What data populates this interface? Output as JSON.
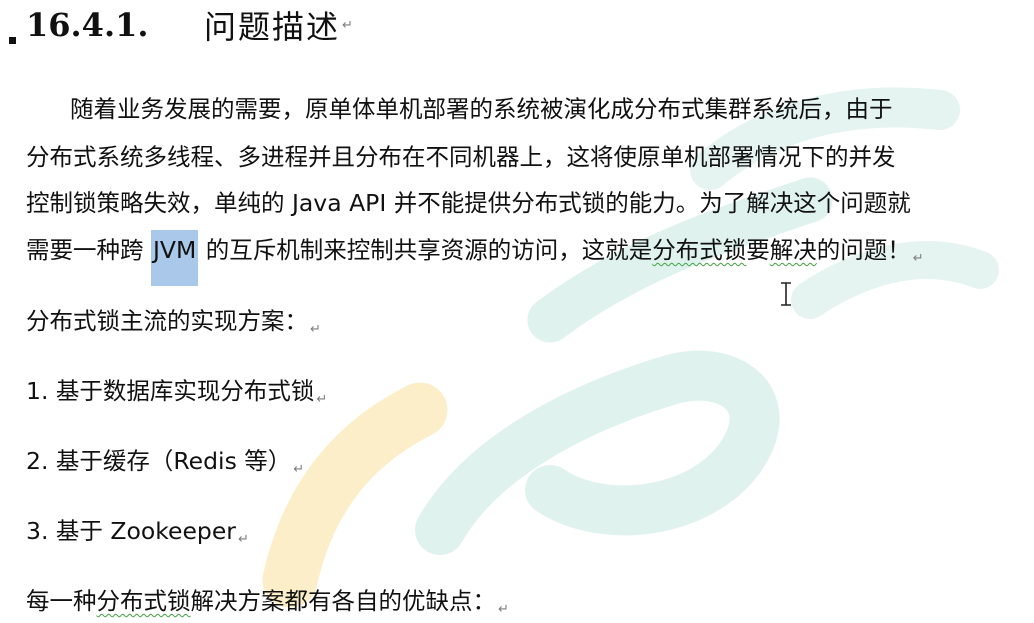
{
  "heading": {
    "number": "16.4.1.",
    "title": "问题描述"
  },
  "para_mark": "↵",
  "paragraph1": {
    "line1": "随着业务发展的需要，原单体单机部署的系统被演化成分布式集群系统后，由于",
    "line2": "分布式系统多线程、多进程并且分布在不同机器上，这将使原单机部署情况下的并发",
    "line3": "控制锁策略失效，单纯的 Java API 并不能提供分布式锁的能力。为了解决这个问题就",
    "line4_a": "需要一种跨 ",
    "line4_selected": "JVM",
    "line4_b": " 的互斥机制来控制共享资源的访问，这就是",
    "line4_squiggle": "分布式锁",
    "line4_c": "要",
    "line4_squiggle2": "解决",
    "line4_d": "的问题！"
  },
  "solutions_intro": "分布式锁主流的实现方案：",
  "solutions": [
    "1. 基于数据库实现分布式锁",
    "2. 基于缓存（Redis 等）",
    "3. 基于 Zookeeper"
  ],
  "closing": {
    "a": "每一种",
    "squiggle": "分布式锁",
    "b": "解决方案都有各自的优缺点："
  },
  "colors": {
    "selection": "#a9c8ea",
    "spell_squiggle": "#3ea33e",
    "watermark_teal": "#d9efe9",
    "watermark_yellow": "#fbeec9"
  }
}
